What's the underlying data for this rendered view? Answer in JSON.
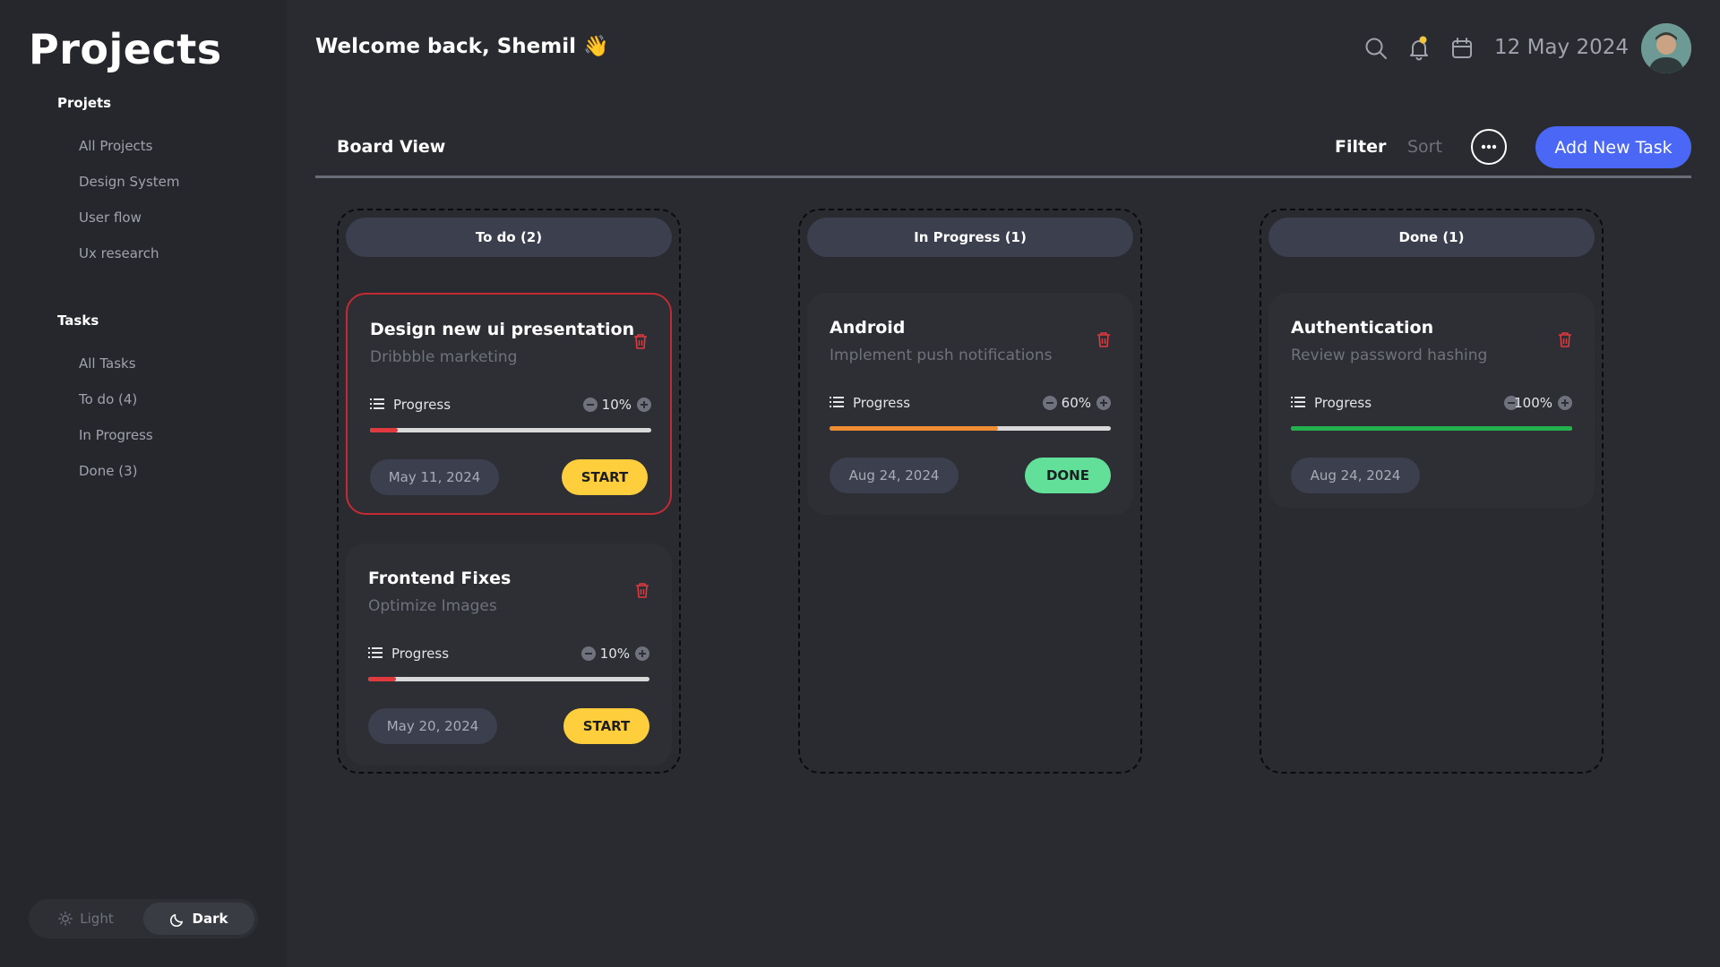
{
  "sidebar": {
    "title": "Projects",
    "projects_label": "Projets",
    "project_items": [
      "All Projects",
      "Design System",
      "User flow",
      "Ux research"
    ],
    "tasks_label": "Tasks",
    "task_items": [
      "All Tasks",
      "To do (4)",
      "In Progress",
      "Done (3)"
    ],
    "theme": {
      "light": "Light",
      "dark": "Dark",
      "selected": "Dark"
    }
  },
  "header": {
    "welcome": "Welcome back, Shemil 👋",
    "date": "12 May 2024",
    "icons": [
      "search-icon",
      "bell-icon",
      "calendar-icon"
    ],
    "notification_dot_color": "#f5c83a"
  },
  "toolbar": {
    "view_label": "Board View",
    "filter_label": "Filter",
    "sort_label": "Sort",
    "add_label": "Add New Task"
  },
  "colors": {
    "accent": "#4a67f5",
    "start": "#ffce3d",
    "done": "#62e09a",
    "danger": "#c22b33",
    "bar_red": "#e0393e",
    "bar_orange": "#f08c32",
    "bar_green": "#22b14c"
  },
  "columns": [
    {
      "header": "To do (2)",
      "cards": [
        {
          "title": "Design new ui presentation",
          "subtitle": "Dribbble marketing",
          "progress_label": "Progress",
          "progress": "10%",
          "progress_fraction": 0.1,
          "bar_color": "#e0393e",
          "date": "May 11, 2024",
          "action": "START",
          "action_color": "#ffce3d"
        },
        {
          "title": "Frontend Fixes",
          "subtitle": "Optimize Images",
          "progress_label": "Progress",
          "progress": "10%",
          "progress_fraction": 0.1,
          "bar_color": "#e0393e",
          "date": "May 20, 2024",
          "action": "START",
          "action_color": "#ffce3d"
        }
      ]
    },
    {
      "header": "In Progress (1)",
      "cards": [
        {
          "title": "Android",
          "subtitle": "Implement push notifications",
          "progress_label": "Progress",
          "progress": "60%",
          "progress_fraction": 0.6,
          "bar_color": "#f08c32",
          "date": "Aug 24, 2024",
          "action": "DONE",
          "action_color": "#62e09a"
        }
      ]
    },
    {
      "header": "Done (1)",
      "cards": [
        {
          "title": "Authentication",
          "subtitle": "Review password hashing",
          "progress_label": "Progress",
          "progress": "100%",
          "progress_fraction": 1.0,
          "bar_color": "#22b14c",
          "date": "Aug 24, 2024",
          "action": "",
          "action_color": ""
        }
      ]
    }
  ]
}
